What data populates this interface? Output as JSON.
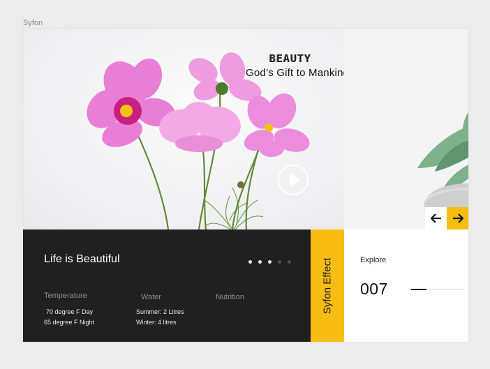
{
  "frame_label": "Syfon",
  "hero": {
    "brand": "BEAUTY",
    "tagline": "God’s  Gift to  Mankind"
  },
  "icons": {
    "play": "play-icon",
    "prev": "arrow-left-icon",
    "next": "arrow-right-icon"
  },
  "colors": {
    "accent": "#f7bd12",
    "dark": "#202020",
    "flower": "#e77fd6"
  },
  "panel": {
    "title": "Life is Beautiful",
    "slides_total": 5,
    "slide_active": 3,
    "stats": [
      {
        "label": "Temperature",
        "lines": [
          "70 degree F Day",
          "65 degree F Night"
        ]
      },
      {
        "label": "Water",
        "lines": [
          "Summer: 2 Litres",
          "Winter: 4 litres"
        ]
      },
      {
        "label": "Nutrition",
        "lines": []
      }
    ]
  },
  "strip": {
    "label": "Syfon Effect"
  },
  "explore": {
    "label": "Explore",
    "number": "007"
  }
}
